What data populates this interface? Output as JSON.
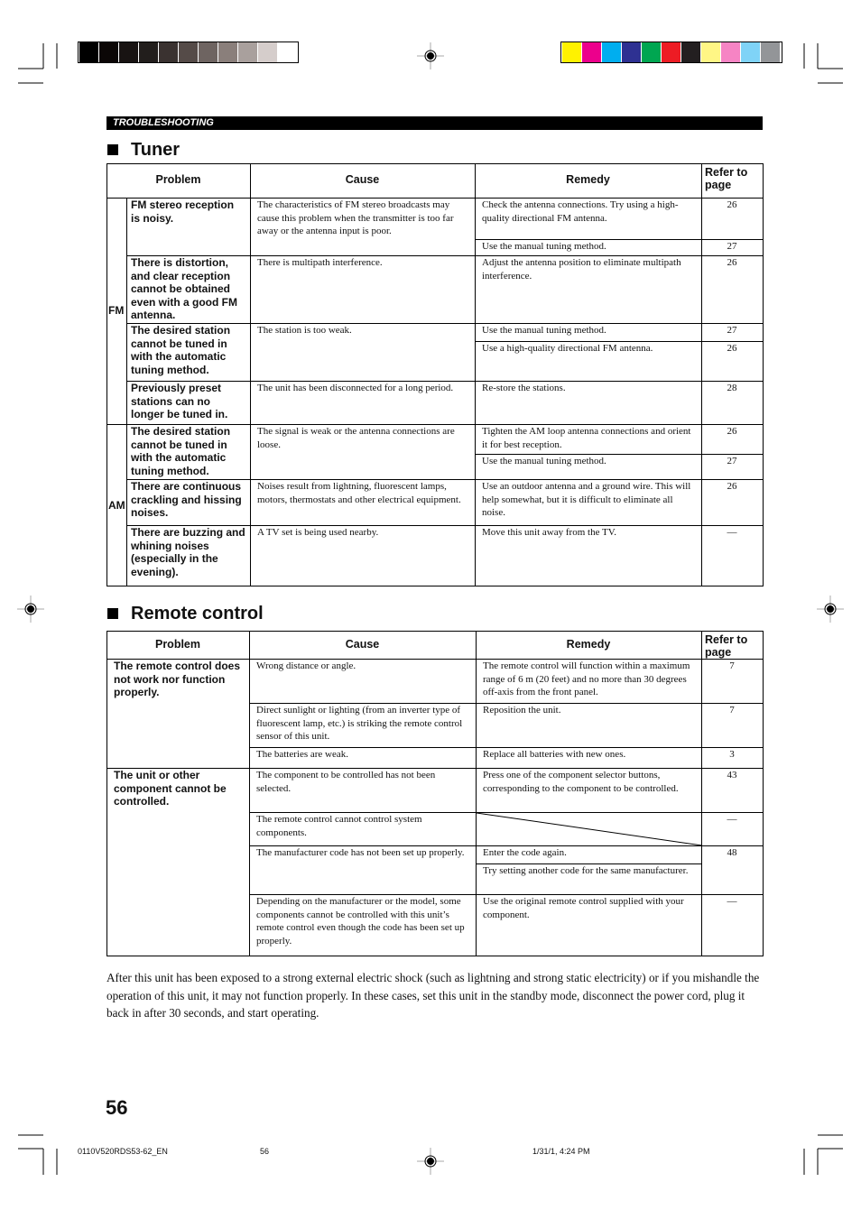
{
  "registration": {
    "grayscale": [
      "#000000",
      "#0b0706",
      "#181312",
      "#221e1c",
      "#3a3230",
      "#554b48",
      "#6e6461",
      "#8a7f7b",
      "#a9a09d",
      "#d5cdcb",
      "#ffffff"
    ],
    "colors": [
      "#fff200",
      "#ec008c",
      "#00aeef",
      "#2e3192",
      "#00a651",
      "#ed1c24",
      "#231f20",
      "#fff685",
      "#f684c4",
      "#7fd3f7",
      "#939598"
    ]
  },
  "header_strip": {
    "label": "TROUBLESHOOTING"
  },
  "tuner": {
    "title": "Tuner",
    "headers": {
      "problem": "Problem",
      "cause": "Cause",
      "remedy": "Remedy",
      "page": "Refer to page"
    },
    "bands": [
      "FM",
      "AM"
    ],
    "rows": [
      {
        "problem": "FM stereo reception is noisy.",
        "cause": "The characteristics of FM stereo broadcasts may cause this problem when the transmitter is too far away or the antenna input is poor.",
        "remedies": [
          {
            "text": "Check the antenna connections. Try using a high-quality directional FM antenna.",
            "page": "26"
          },
          {
            "text": "Use the manual tuning method.",
            "page": "27"
          }
        ]
      },
      {
        "problem": "There is distortion, and clear reception cannot be obtained even with a good FM antenna.",
        "cause": "There is multipath interference.",
        "remedies": [
          {
            "text": "Adjust the antenna position to eliminate multipath interference.",
            "page": "26"
          }
        ]
      },
      {
        "problem": "The desired station cannot be tuned in with the automatic tuning method.",
        "cause": "The station is too weak.",
        "remedies": [
          {
            "text": "Use the manual tuning method.",
            "page": "27"
          },
          {
            "text": "Use a high-quality directional FM antenna.",
            "page": "26"
          }
        ]
      },
      {
        "problem": "Previously preset stations can no longer be tuned in.",
        "cause": "The unit has been disconnected for a long period.",
        "remedies": [
          {
            "text": "Re-store the stations.",
            "page": "28"
          }
        ]
      },
      {
        "problem": "The desired station cannot be tuned in with the automatic tuning method.",
        "cause": "The signal is weak or the antenna connections are loose.",
        "remedies": [
          {
            "text": "Tighten the AM loop antenna connections and orient it for best reception.",
            "page": "26"
          },
          {
            "text": "Use the manual tuning method.",
            "page": "27"
          }
        ]
      },
      {
        "problem": "There are continuous crackling and hissing noises.",
        "cause": "Noises result from lightning, fluorescent lamps, motors, thermostats and other electrical equipment.",
        "remedies": [
          {
            "text": "Use an outdoor antenna and a ground wire. This will help somewhat, but it is difficult to eliminate all noise.",
            "page": "26"
          }
        ]
      },
      {
        "problem": "There are buzzing and whining noises (especially in the evening).",
        "cause": "A TV set is being used nearby.",
        "remedies": [
          {
            "text": "Move this unit away from the TV.",
            "page": "—"
          }
        ]
      }
    ]
  },
  "remote": {
    "title": "Remote control",
    "headers": {
      "problem": "Problem",
      "cause": "Cause",
      "remedy": "Remedy",
      "page": "Refer to page"
    },
    "groups": [
      {
        "problem": "The remote control does not work nor function properly.",
        "items": [
          {
            "cause": "Wrong distance or angle.",
            "remedies": [
              "The remote control will function within a maximum range of 6 m (20 feet) and no more than 30 degrees off-axis from the front panel."
            ],
            "page": "7"
          },
          {
            "cause": "Direct sunlight or lighting (from an inverter type of fluorescent lamp, etc.) is striking the remote control sensor of this unit.",
            "remedies": [
              "Reposition the unit."
            ],
            "page": "7"
          },
          {
            "cause": "The batteries are weak.",
            "remedies": [
              "Replace all batteries with new ones."
            ],
            "page": "3"
          }
        ]
      },
      {
        "problem": "The unit or other component cannot be controlled.",
        "items": [
          {
            "cause": "The component to be controlled has not been selected.",
            "remedies": [
              "Press one of the component selector buttons, corresponding to the component to be controlled."
            ],
            "page": "43"
          },
          {
            "cause": "The remote control cannot control system components.",
            "remedies": [],
            "page": "—"
          },
          {
            "cause": "The manufacturer code has not been set up properly.",
            "remedies": [
              "Enter the code again.",
              "Try setting another code for the same manufacturer."
            ],
            "page": "48"
          },
          {
            "cause": "Depending on the manufacturer or the model, some components cannot be controlled with this unit’s remote control even though the code has been set up properly.",
            "remedies": [
              "Use the original remote control supplied with your component."
            ],
            "page": "—"
          }
        ]
      }
    ]
  },
  "note": "After this unit has been exposed to a strong external electric shock (such as lightning and strong static electricity) or if you mishandle the operation of this unit, it may not function properly. In these cases, set this unit in the standby mode, disconnect the power cord, plug it back in after 30 seconds, and start operating.",
  "page_number": "56",
  "footer": {
    "file": "0110V520RDS53-62_EN",
    "page": "56",
    "date": "1/31/1, 4:24 PM"
  }
}
